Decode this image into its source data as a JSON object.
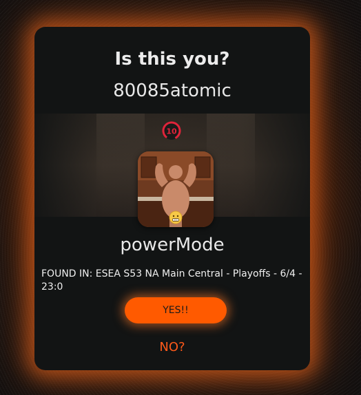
{
  "dialog": {
    "title": "Is this you?",
    "username": "80085atomic",
    "level": "10",
    "player_name": "powerMode",
    "found_in": "FOUND IN: ESEA S53 NA Main Central - Playoffs - 6/4 - 23:0",
    "yes_label": "YES!!",
    "no_label": "NO?"
  },
  "colors": {
    "accent": "#ff5a00",
    "modal_bg": "#121414",
    "level_ring": "#e0243a"
  },
  "icons": {
    "level": "level-badge-icon",
    "emoji": "grimace-emoji-icon"
  }
}
